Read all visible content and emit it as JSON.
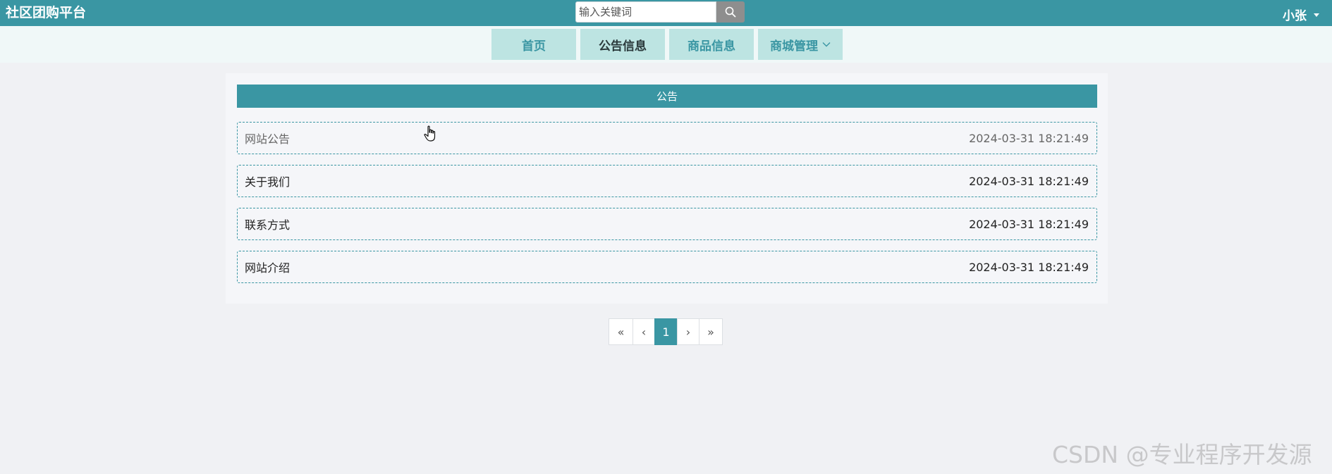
{
  "brand": "社区团购平台",
  "search": {
    "placeholder": "输入关键词",
    "icon": "search-icon"
  },
  "user": {
    "name": "小张",
    "dropdown_icon": "caret-down-icon"
  },
  "nav": {
    "items": [
      {
        "label": "首页",
        "active": false
      },
      {
        "label": "公告信息",
        "active": true
      },
      {
        "label": "商品信息",
        "active": false
      },
      {
        "label": "商城管理",
        "active": false,
        "has_dropdown": true
      }
    ]
  },
  "notice": {
    "header": "公告",
    "rows": [
      {
        "title": "网站公告",
        "time": "2024-03-31 18:21:49"
      },
      {
        "title": "关于我们",
        "time": "2024-03-31 18:21:49"
      },
      {
        "title": "联系方式",
        "time": "2024-03-31 18:21:49"
      },
      {
        "title": "网站介绍",
        "time": "2024-03-31 18:21:49"
      }
    ]
  },
  "pagination": {
    "first": "«",
    "prev": "‹",
    "current": "1",
    "next": "›",
    "last": "»"
  },
  "watermark": "CSDN @专业程序开发源",
  "colors": {
    "primary": "#3a96a3",
    "nav_item_bg": "#bde4e2",
    "page_bg": "#f0f1f4"
  }
}
